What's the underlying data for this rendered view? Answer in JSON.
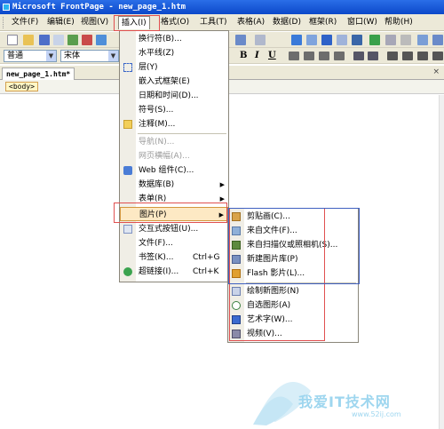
{
  "window": {
    "title": "Microsoft FrontPage - new_page_1.htm"
  },
  "menubar": {
    "items": [
      {
        "label": "文件(F)"
      },
      {
        "label": "编辑(E)"
      },
      {
        "label": "视图(V)"
      },
      {
        "label": "插入(I)"
      },
      {
        "label": "格式(O)"
      },
      {
        "label": "工具(T)"
      },
      {
        "label": "表格(A)"
      },
      {
        "label": "数据(D)"
      },
      {
        "label": "框架(R)"
      },
      {
        "label": "窗口(W)"
      },
      {
        "label": "帮助(H)"
      }
    ]
  },
  "formatting": {
    "style_value": "普通",
    "font_value": "宋体",
    "bold": "B",
    "italic": "I",
    "underline": "U"
  },
  "document": {
    "tab_label": "new_page_1.htm*",
    "tab_close": "×",
    "body_tag": "<body>"
  },
  "insert_menu": {
    "items": [
      {
        "label": "换行符(B)...",
        "disabled": false
      },
      {
        "label": "水平线(Z)",
        "disabled": false
      },
      {
        "label": "层(Y)",
        "disabled": false
      },
      {
        "label": "嵌入式框架(E)",
        "disabled": false
      },
      {
        "label": "日期和时间(D)...",
        "disabled": false
      },
      {
        "label": "符号(S)...",
        "disabled": false
      },
      {
        "label": "注释(M)...",
        "disabled": false
      },
      {
        "label": "导航(N)...",
        "disabled": true
      },
      {
        "label": "网页横幅(A)...",
        "disabled": true
      },
      {
        "label": "Web 组件(C)...",
        "disabled": false
      },
      {
        "label": "数据库(B)",
        "disabled": false
      },
      {
        "label": "表单(R)",
        "disabled": false
      },
      {
        "label": "图片(P)",
        "disabled": false
      },
      {
        "label": "交互式按钮(U)...",
        "disabled": false
      },
      {
        "label": "文件(F)...",
        "disabled": false
      },
      {
        "label": "书签(K)...",
        "shortcut": "Ctrl+G",
        "disabled": false
      },
      {
        "label": "超链接(I)...",
        "shortcut": "Ctrl+K",
        "disabled": false
      }
    ]
  },
  "picture_submenu": {
    "items": [
      {
        "label": "剪贴画(C)..."
      },
      {
        "label": "来自文件(F)..."
      },
      {
        "label": "来自扫描仪或照相机(S)..."
      },
      {
        "label": "新建图片库(P)"
      },
      {
        "label": "Flash 影片(L)..."
      },
      {
        "label": "绘制新图形(N)"
      },
      {
        "label": "自选图形(A)"
      },
      {
        "label": "艺术字(W)..."
      },
      {
        "label": "视频(V)..."
      }
    ]
  },
  "watermark": {
    "text": "我爱IT技术网",
    "url": "www.52ij.com"
  },
  "colors": {
    "title_bar": "#0b48c9",
    "menu_highlight": "#fde9c4",
    "annotation_red": "#e05050",
    "annotation_blue": "#4060c0"
  }
}
